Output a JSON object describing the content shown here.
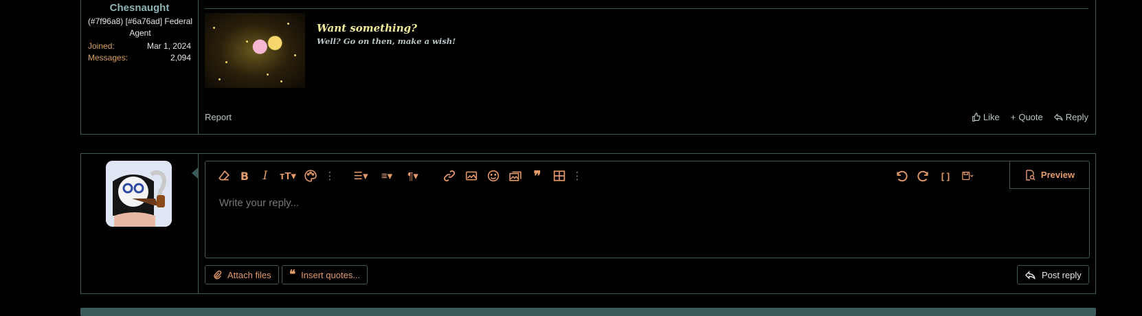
{
  "post": {
    "username": "Chesnaught",
    "user_title": "(#7f96a8) [#6a76ad] Federal Agent",
    "stats": [
      {
        "label": "Joined:",
        "value": "Mar 1, 2024"
      },
      {
        "label": "Messages:",
        "value": "2,094"
      }
    ],
    "signature_title": "Want something?",
    "signature_subtitle": "Well? Go on then, make a wish!",
    "report_label": "Report",
    "actions": {
      "like": "Like",
      "quote": "Quote",
      "reply": "Reply"
    }
  },
  "reply": {
    "placeholder": "Write your reply...",
    "preview_label": "Preview",
    "attach_label": "Attach files",
    "insert_quotes_label": "Insert quotes...",
    "post_reply_label": "Post reply"
  },
  "colors": {
    "accent": "#e59a6a",
    "border": "#3d5a5a",
    "username": "#8fb3b3"
  }
}
